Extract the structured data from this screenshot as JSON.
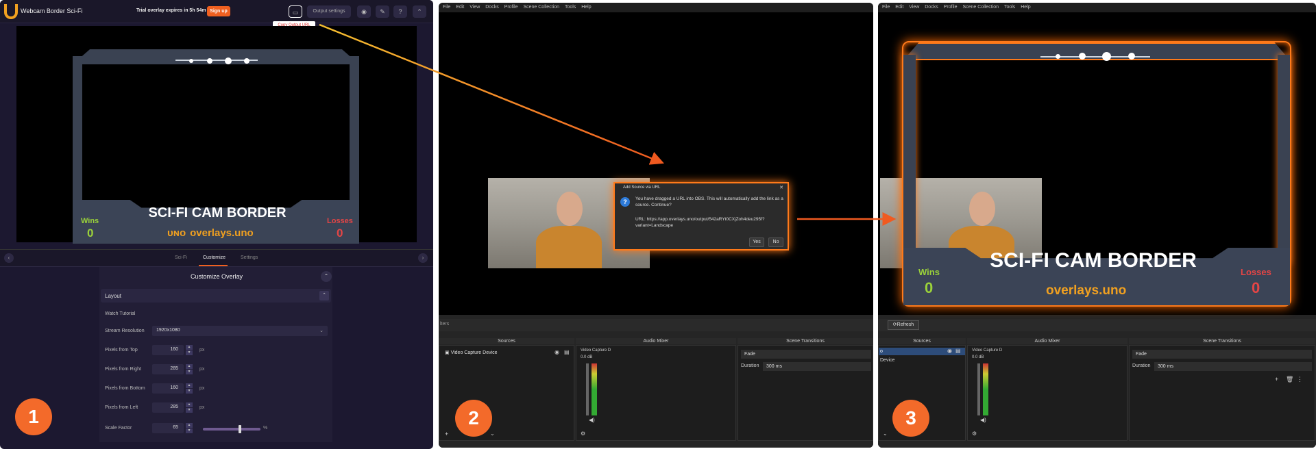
{
  "panel1": {
    "app_title": "Webcam Border Sci-Fi",
    "trial_text": "Trial overlay expires in 5h 54m 44s",
    "signup_label": "Sign up",
    "output_settings_label": "Output settings",
    "tooltip": "Copy Output URL",
    "overlay": {
      "banner": "SCI-FI CAM BORDER",
      "site": "overlays.uno",
      "wins_label": "Wins",
      "wins_value": "0",
      "losses_label": "Losses",
      "losses_value": "0"
    },
    "tabs": [
      "Sci-Fi",
      "Customize",
      "Settings"
    ],
    "active_tab": "Customize",
    "customize_title": "Customize Overlay",
    "layout_label": "Layout",
    "watch_tutorial": "Watch Tutorial",
    "stream_resolution_label": "Stream Resolution",
    "stream_resolution_value": "1920x1080",
    "fields": [
      {
        "label": "Pixels from Top",
        "value": "160",
        "unit": "px"
      },
      {
        "label": "Pixels from Right",
        "value": "285",
        "unit": "px"
      },
      {
        "label": "Pixels from Bottom",
        "value": "160",
        "unit": "px"
      },
      {
        "label": "Pixels from Left",
        "value": "285",
        "unit": "px"
      },
      {
        "label": "Scale Factor",
        "value": "65",
        "unit": "%"
      }
    ],
    "scale_factor_fraction": 0.65,
    "step_badge": "1"
  },
  "panel2": {
    "menu": [
      "File",
      "Edit",
      "View",
      "Docks",
      "Profile",
      "Scene Collection",
      "Tools",
      "Help"
    ],
    "dialog": {
      "title": "Add Source via URL",
      "message": "You have dragged a URL into OBS. This will automatically add the link as a source. Continue?",
      "url": "URL: https://app.overlays.uno/output/542aRYt0CXjZoh4deu295f?variant=Landscape",
      "yes": "Yes",
      "no": "No"
    },
    "filters_tab": "lters",
    "sources_header": "Sources",
    "source_item": "Video Capture Device",
    "audio_header": "Audio Mixer",
    "audio_channel": "Video Capture D",
    "audio_db": "0.0 dB",
    "transitions_header": "Scene Transitions",
    "transition": "Fade",
    "duration_label": "Duration",
    "duration_value": "300 ms",
    "step_badge": "2"
  },
  "panel3": {
    "menu": [
      "File",
      "Edit",
      "View",
      "Docks",
      "Profile",
      "Scene Collection",
      "Tools",
      "Help"
    ],
    "refresh_label": "Refresh",
    "sources_header": "Sources",
    "source_item_1": "o",
    "source_item_2": "Device",
    "audio_header": "Audio Mixer",
    "audio_channel": "Video Capture D",
    "audio_db": "0.0 dB",
    "transitions_header": "Scene Transitions",
    "transition": "Fade",
    "duration_label": "Duration",
    "duration_value": "300 ms",
    "overlay": {
      "banner": "SCI-FI CAM BORDER",
      "site": "overlays.uno",
      "wins_label": "Wins",
      "wins_value": "0",
      "losses_label": "Losses",
      "losses_value": "0"
    },
    "step_badge": "3"
  },
  "colors": {
    "accent": "#f36a2a",
    "wins": "#9bd23a",
    "losses": "#e64545",
    "site": "#f0a020"
  }
}
